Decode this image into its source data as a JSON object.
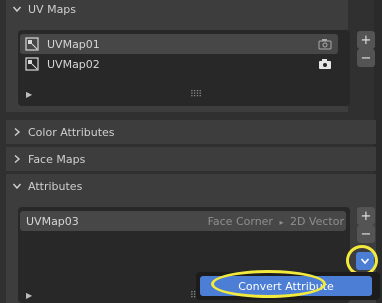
{
  "uv_maps": {
    "header": "UV Maps",
    "items": [
      {
        "label": "UVMap01",
        "selected": true,
        "active_render": false
      },
      {
        "label": "UVMap02",
        "selected": false,
        "active_render": true
      }
    ],
    "add": "+",
    "remove": "−"
  },
  "collapsed_panels": [
    {
      "label": "Color Attributes"
    },
    {
      "label": "Face Maps"
    }
  ],
  "attributes": {
    "header": "Attributes",
    "items": [
      {
        "label": "UVMap03",
        "domain": "Face Corner",
        "sep": "▸",
        "type": "2D Vector"
      }
    ],
    "add": "+",
    "remove": "−"
  },
  "menu": {
    "item": "Convert Attribute"
  },
  "colors": {
    "accent": "#4c7ed6",
    "highlight": "#f2ea3c"
  }
}
